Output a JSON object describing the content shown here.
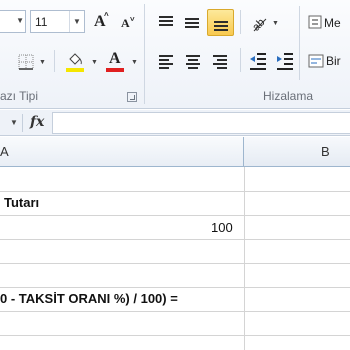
{
  "ribbon": {
    "font_group": {
      "label": "azı Tipi",
      "font_size": "11",
      "grow_font": "A",
      "shrink_font": "A",
      "fill_color": "#f5e600",
      "font_color": "#e02020"
    },
    "alignment_group": {
      "label": "Hizalama",
      "merge_label": "Me",
      "wrap_label": "Bir"
    }
  },
  "formula_bar": {
    "fx": "fx",
    "value": ""
  },
  "columns": {
    "a": "A",
    "b": "B"
  },
  "cells": {
    "row2": "Tutarı",
    "row3": "100",
    "row6": "0 - TAKSİT ORANI %) / 100) ="
  }
}
